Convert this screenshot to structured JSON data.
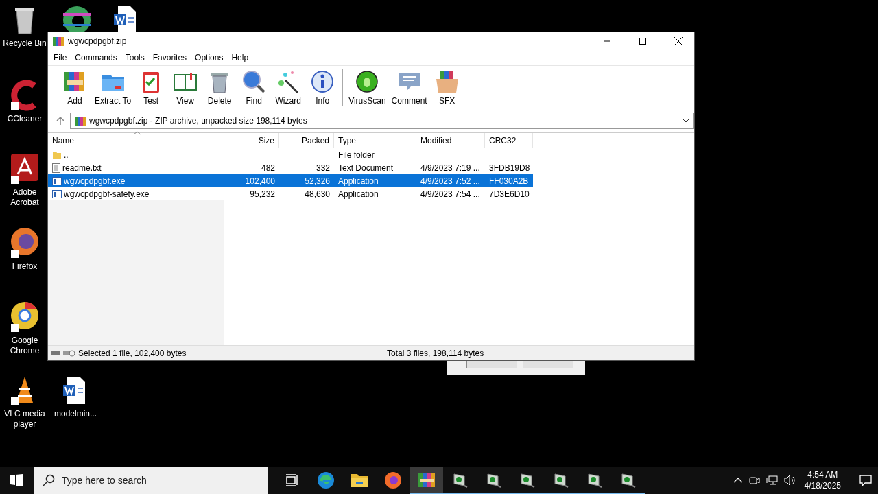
{
  "desktop_icons": [
    {
      "kind": "recycle",
      "label": "Recycle Bin"
    },
    {
      "kind": "edge"
    },
    {
      "kind": "word"
    },
    {
      "kind": "ccleaner",
      "label": "CCleaner"
    },
    {
      "kind": "acrobat",
      "label": "Adobe Acrobat"
    },
    {
      "kind": "firefox",
      "label": "Firefox"
    },
    {
      "kind": "chrome",
      "label": "Google Chrome"
    },
    {
      "kind": "vlc",
      "label": "VLC media player"
    },
    {
      "kind": "word",
      "label": "modelmin..."
    }
  ],
  "window": {
    "title": "wgwcpdpgbf.zip",
    "menu": [
      "File",
      "Commands",
      "Tools",
      "Favorites",
      "Options",
      "Help"
    ],
    "toolbar_groups": [
      {
        "buttons": [
          {
            "kind": "add",
            "label": "Add"
          },
          {
            "kind": "extract",
            "label": "Extract To"
          },
          {
            "kind": "test",
            "label": "Test"
          },
          {
            "kind": "view",
            "label": "View"
          },
          {
            "kind": "delete",
            "label": "Delete"
          },
          {
            "kind": "find",
            "label": "Find"
          },
          {
            "kind": "wizard",
            "label": "Wizard"
          },
          {
            "kind": "info",
            "label": "Info"
          }
        ]
      },
      {
        "buttons": [
          {
            "kind": "virusscan",
            "label": "VirusScan"
          },
          {
            "kind": "comment",
            "label": "Comment"
          },
          {
            "kind": "sfx",
            "label": "SFX"
          }
        ]
      }
    ],
    "path": "wgwcpdpgbf.zip - ZIP archive, unpacked size 198,114 bytes",
    "columns": [
      "Name",
      "Size",
      "Packed",
      "Type",
      "Modified",
      "CRC32"
    ],
    "rows": [
      {
        "kind": "folder",
        "name": "..",
        "size": "",
        "packed": "",
        "type": "File folder",
        "modified": "",
        "crc32": "",
        "selected": false
      },
      {
        "kind": "text",
        "name": "readme.txt",
        "size": "482",
        "packed": "332",
        "type": "Text Document",
        "modified": "4/9/2023 7:19 ...",
        "crc32": "3FDB19D8",
        "selected": false
      },
      {
        "kind": "exe",
        "name": "wgwcpdpgbf.exe",
        "size": "102,400",
        "packed": "52,326",
        "type": "Application",
        "modified": "4/9/2023 7:52 ...",
        "crc32": "FF030A2B",
        "selected": true
      },
      {
        "kind": "exe",
        "name": "wgwcpdpgbf-safety.exe",
        "size": "95,232",
        "packed": "48,630",
        "type": "Application",
        "modified": "4/9/2023 7:54 ...",
        "crc32": "7D3E6D10",
        "selected": false
      }
    ],
    "status_left": "Selected 1 file, 102,400 bytes",
    "status_right": "Total 3 files, 198,114 bytes"
  },
  "taskbar": {
    "search_placeholder": "Type here to search",
    "apps": [
      {
        "kind": "taskview",
        "active": false,
        "running": false
      },
      {
        "kind": "edge",
        "active": false,
        "running": false
      },
      {
        "kind": "explorer",
        "active": false,
        "running": false
      },
      {
        "kind": "firefox",
        "active": false,
        "running": false
      },
      {
        "kind": "winrar",
        "active": true,
        "running": true
      },
      {
        "kind": "app",
        "active": false,
        "running": true
      },
      {
        "kind": "app",
        "active": false,
        "running": true
      },
      {
        "kind": "app",
        "active": false,
        "running": true
      },
      {
        "kind": "app",
        "active": false,
        "running": true
      },
      {
        "kind": "app",
        "active": false,
        "running": true
      },
      {
        "kind": "app",
        "active": false,
        "running": true
      }
    ],
    "time": "4:54 AM",
    "date": "4/18/2025"
  }
}
